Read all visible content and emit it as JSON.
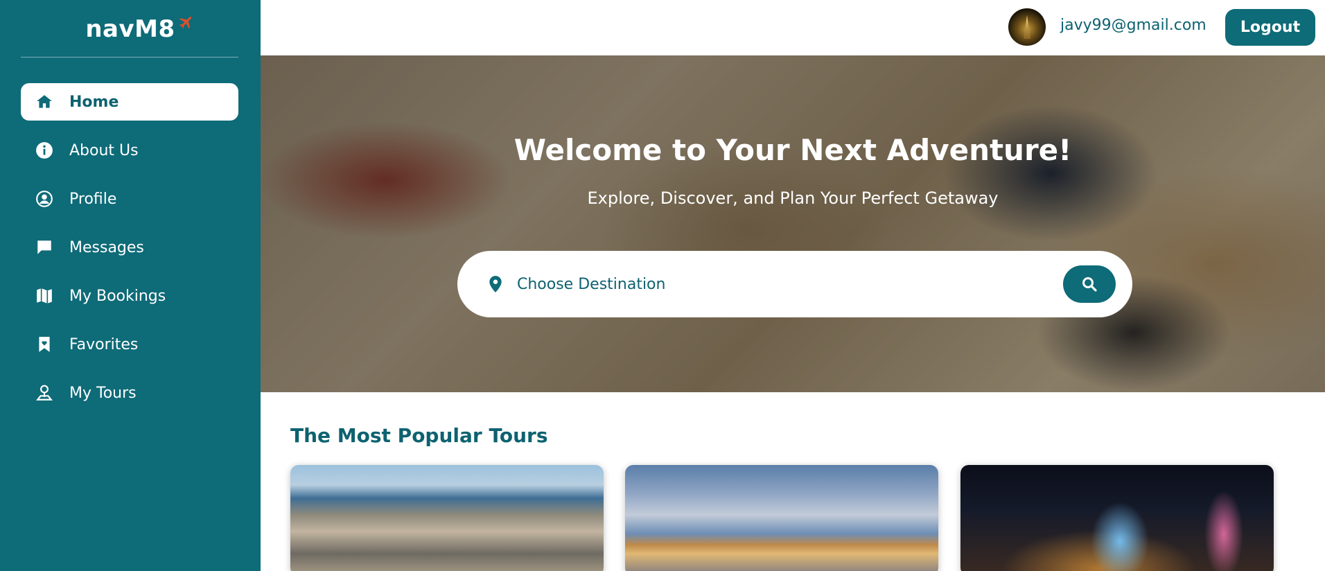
{
  "app": {
    "logo_text": "navM8"
  },
  "sidebar": {
    "items": [
      {
        "label": "Home",
        "icon": "home-icon",
        "active": true
      },
      {
        "label": "About Us",
        "icon": "info-icon",
        "active": false
      },
      {
        "label": "Profile",
        "icon": "user-circle-icon",
        "active": false
      },
      {
        "label": "Messages",
        "icon": "chat-icon",
        "active": false
      },
      {
        "label": "My Bookings",
        "icon": "map-icon",
        "active": false
      },
      {
        "label": "Favorites",
        "icon": "bookmark-heart-icon",
        "active": false
      },
      {
        "label": "My Tours",
        "icon": "tour-pin-icon",
        "active": false
      }
    ]
  },
  "header": {
    "user_email": "javy99@gmail.com",
    "logout_label": "Logout"
  },
  "hero": {
    "title": "Welcome to Your Next Adventure!",
    "subtitle": "Explore, Discover, and Plan Your Perfect Getaway",
    "search_placeholder": "Choose Destination"
  },
  "popular": {
    "title": "The Most Popular Tours"
  },
  "colors": {
    "brand": "#0e6b78",
    "accent_plane": "#e0502a",
    "white": "#ffffff"
  }
}
